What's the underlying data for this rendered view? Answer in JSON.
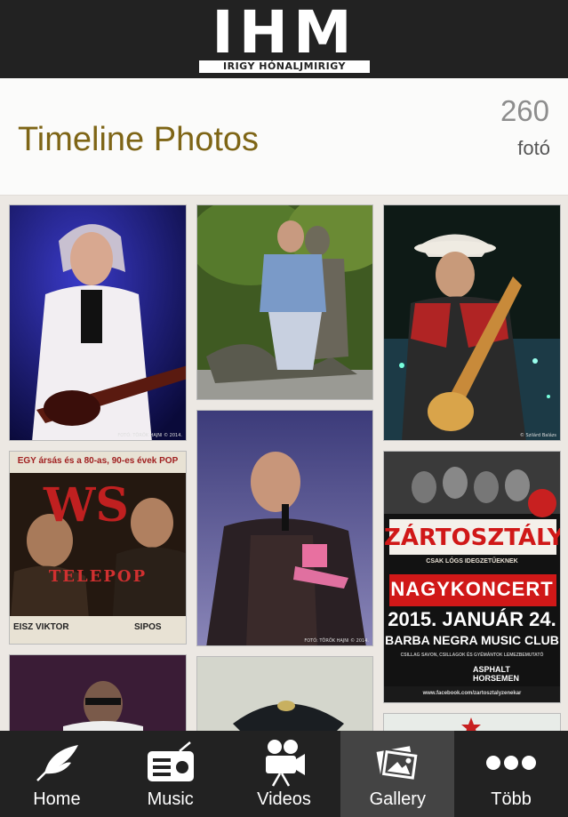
{
  "header": {
    "logo_text": "IHM",
    "logo_subtext": "IRIGY HÓNALJMIRIGY"
  },
  "album": {
    "title": "Timeline Photos",
    "count": "260",
    "count_unit": "fotó"
  },
  "photos": [
    {
      "caption": "FOTÓ: TÖRÖK HAJNI © 2014."
    },
    {
      "caption": ""
    },
    {
      "caption": "© Szilárd Balázs"
    },
    {
      "caption": "",
      "banner": "EGY ársás és a 80-as, 90-es évek POP",
      "ws": "WS",
      "telepop": "TELEPOP",
      "name1": "EISZ VIKTOR",
      "name2": "SIPOS"
    },
    {
      "caption": "FOTÓ: TÖRÖK HAJNI © 2014."
    },
    {
      "caption": "",
      "headline": "ZÁRTOSZTÁLY",
      "subline": "CSAK LÓGS IDEGZETŰEKNEK",
      "concert": "NAGYKONCERT",
      "date": "2015. JANUÁR 24.",
      "venue": "BARBA NEGRA MUSIC CLUB",
      "tagline": "CSILLAG SAVON, CSILLAGOK ÉS GYÉMÁNTOK LEMEZBEMUTATÓ",
      "sponsor": "ASPHALT HORSEMEN",
      "facebook": "www.facebook.com/zartosztalyzenekar"
    },
    {
      "caption": ""
    },
    {
      "caption": ""
    },
    {
      "caption": ""
    }
  ],
  "tabs": [
    {
      "label": "Home",
      "icon": "feather-icon",
      "active": false
    },
    {
      "label": "Music",
      "icon": "radio-icon",
      "active": false
    },
    {
      "label": "Videos",
      "icon": "video-camera-icon",
      "active": false
    },
    {
      "label": "Gallery",
      "icon": "gallery-icon",
      "active": true
    },
    {
      "label": "Több",
      "icon": "more-dots-icon",
      "active": false
    }
  ],
  "colors": {
    "title": "#7e6516",
    "header_bg": "#222222",
    "tab_active_bg": "#444444"
  }
}
